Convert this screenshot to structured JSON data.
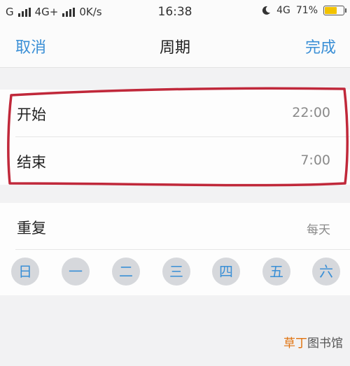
{
  "status_bar": {
    "carrier1": "G",
    "carrier2": "4G+",
    "speed": "0K/s",
    "time": "16:38",
    "network": "4G",
    "battery_text": "71%",
    "battery_level": 0.71
  },
  "nav": {
    "cancel_label": "取消",
    "title": "周期",
    "done_label": "完成"
  },
  "period": {
    "start_label": "开始",
    "start_value": "22:00",
    "end_label": "结束",
    "end_value": "7:00"
  },
  "repeat": {
    "label": "重复",
    "value": "每天",
    "days": [
      "日",
      "一",
      "二",
      "三",
      "四",
      "五",
      "六"
    ]
  },
  "watermark": {
    "part1": "草丁",
    "part2": "图书馆"
  },
  "colors": {
    "accent": "#3a8fd6",
    "annotation": "#c0283a",
    "battery": "#f2c200"
  }
}
